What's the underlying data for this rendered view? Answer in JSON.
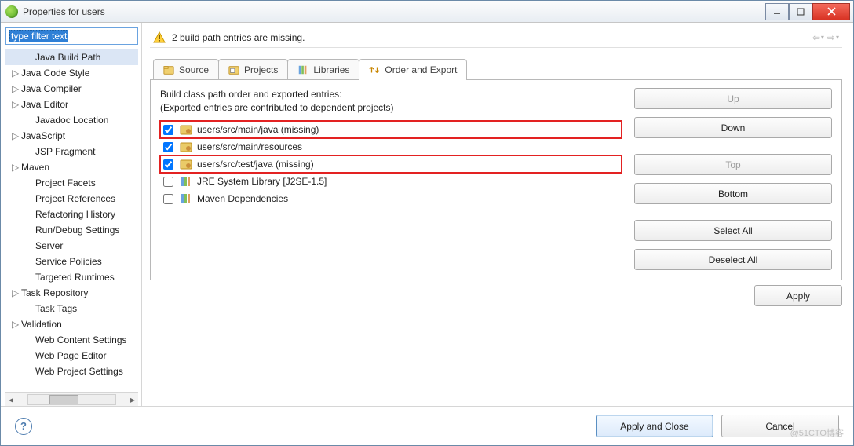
{
  "title": "Properties for users",
  "filter_placeholder": "type filter text",
  "tree": {
    "items": [
      {
        "label": "Java Build Path",
        "level": 2,
        "expandable": false,
        "selected": true
      },
      {
        "label": "Java Code Style",
        "level": 1,
        "expandable": true
      },
      {
        "label": "Java Compiler",
        "level": 1,
        "expandable": true
      },
      {
        "label": "Java Editor",
        "level": 1,
        "expandable": true
      },
      {
        "label": "Javadoc Location",
        "level": 2
      },
      {
        "label": "JavaScript",
        "level": 1,
        "expandable": true
      },
      {
        "label": "JSP Fragment",
        "level": 2
      },
      {
        "label": "Maven",
        "level": 1,
        "expandable": true
      },
      {
        "label": "Project Facets",
        "level": 2
      },
      {
        "label": "Project References",
        "level": 2
      },
      {
        "label": "Refactoring History",
        "level": 2
      },
      {
        "label": "Run/Debug Settings",
        "level": 2
      },
      {
        "label": "Server",
        "level": 2
      },
      {
        "label": "Service Policies",
        "level": 2
      },
      {
        "label": "Targeted Runtimes",
        "level": 2
      },
      {
        "label": "Task Repository",
        "level": 1,
        "expandable": true
      },
      {
        "label": "Task Tags",
        "level": 2
      },
      {
        "label": "Validation",
        "level": 1,
        "expandable": true
      },
      {
        "label": "Web Content Settings",
        "level": 2
      },
      {
        "label": "Web Page Editor",
        "level": 2
      },
      {
        "label": "Web Project Settings",
        "level": 2
      }
    ]
  },
  "banner": {
    "text": "2 build path entries are missing."
  },
  "tabs": [
    {
      "id": "source",
      "label": "Source",
      "icon": "source-folder-icon"
    },
    {
      "id": "projects",
      "label": "Projects",
      "icon": "projects-icon"
    },
    {
      "id": "libraries",
      "label": "Libraries",
      "icon": "libraries-icon"
    },
    {
      "id": "order",
      "label": "Order and Export",
      "icon": "order-export-icon",
      "active": true
    }
  ],
  "order": {
    "desc1": "Build class path order and exported entries:",
    "desc2": "(Exported entries are contributed to dependent projects)",
    "entries": [
      {
        "label": "users/src/main/java (missing)",
        "checked": true,
        "icon": "package-folder-icon",
        "highlight": true
      },
      {
        "label": "users/src/main/resources",
        "checked": true,
        "icon": "package-folder-icon"
      },
      {
        "label": "users/src/test/java (missing)",
        "checked": true,
        "icon": "package-folder-icon",
        "highlight": true
      },
      {
        "label": "JRE System Library [J2SE-1.5]",
        "checked": false,
        "icon": "library-icon"
      },
      {
        "label": "Maven Dependencies",
        "checked": false,
        "icon": "library-icon"
      }
    ],
    "buttons": {
      "up": "Up",
      "down": "Down",
      "top": "Top",
      "bottom": "Bottom",
      "selectall": "Select All",
      "deselectall": "Deselect All"
    }
  },
  "apply": "Apply",
  "footer": {
    "applyClose": "Apply and Close",
    "cancel": "Cancel"
  },
  "watermark": "@51CTO博客"
}
